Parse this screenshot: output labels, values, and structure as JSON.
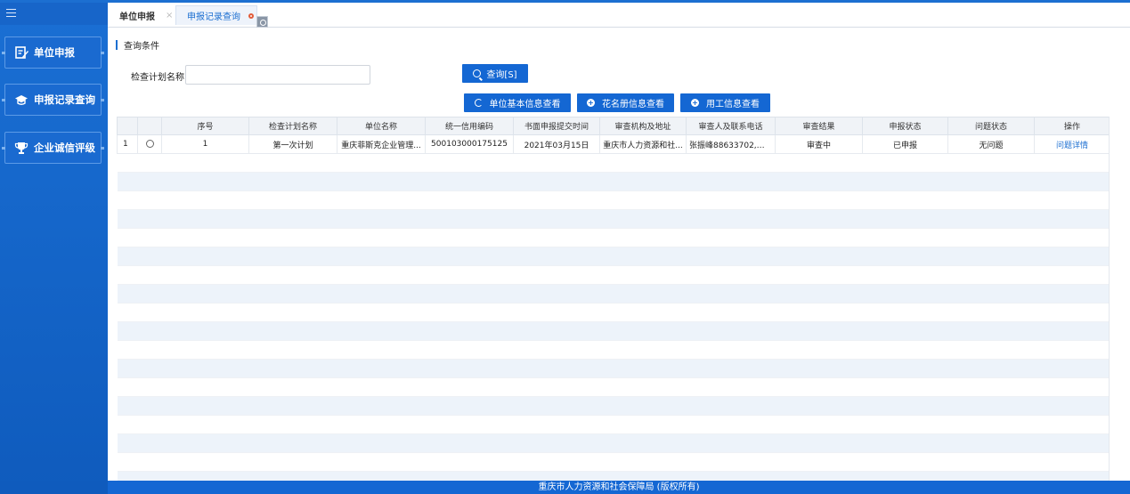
{
  "sidebar": {
    "toggle_icon": "menu-icon",
    "items": [
      {
        "label": "单位申报",
        "icon": "edit-icon"
      },
      {
        "label": "申报记录查询",
        "icon": "graduation-cap-icon"
      },
      {
        "label": "企业诚信评级",
        "icon": "trophy-icon"
      }
    ]
  },
  "tabs": [
    {
      "label": "单位申报",
      "close": "×"
    },
    {
      "label": "申报记录查询"
    }
  ],
  "query": {
    "section_title": "查询条件",
    "plan_label": "检查计划名称",
    "plan_value": "",
    "plan_placeholder": "",
    "search_button": "查询[S]"
  },
  "actions": {
    "unit_info": "单位基本信息查看",
    "roster_info": "花名册信息查看",
    "employment_info": "用工信息查看"
  },
  "table": {
    "headers": [
      "序号",
      "检查计划名称",
      "单位名称",
      "统一信用编码",
      "书面申报提交时间",
      "审查机构及地址",
      "审查人及联系电话",
      "审查结果",
      "申报状态",
      "问题状态",
      "操作"
    ],
    "rows": [
      {
        "row_no": "1",
        "seq": "1",
        "plan_name": "第一次计划",
        "unit_name": "重庆菲斯克企业管理...",
        "credit_code": "500103000175125",
        "submit_time": "2021年03月15日",
        "agency": "重庆市人力资源和社...",
        "reviewer": "张振峰88633702,余...",
        "review_result": "审查中",
        "declare_status": "已申报",
        "issue_status": "无问题",
        "action": "问题详情"
      }
    ]
  },
  "footer": {
    "text": "重庆市人力资源和社会保障局 (版权所有)"
  },
  "colors": {
    "brand": "#1467d3",
    "sidebar": "#1a6ad0",
    "stripe": "#edf3fa"
  }
}
